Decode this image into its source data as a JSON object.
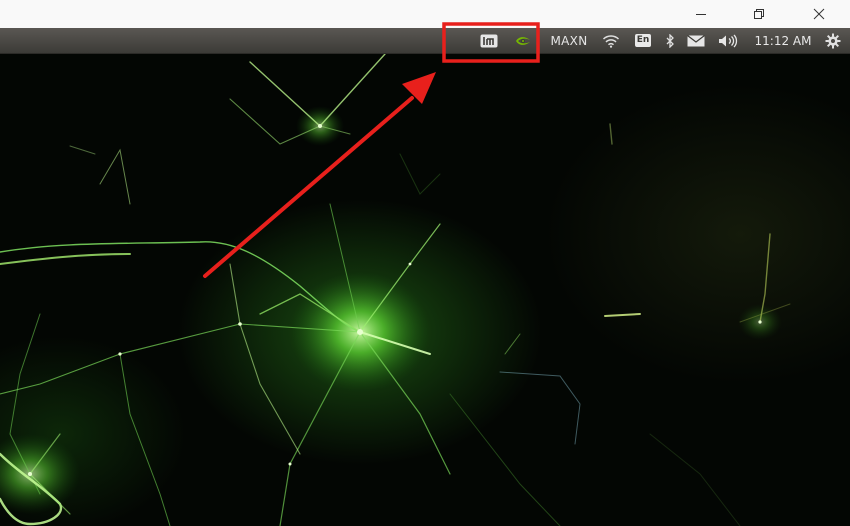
{
  "window_controls": {
    "minimize_icon": "minimize-icon",
    "maximize_icon": "restore-icon",
    "close_icon": "close-icon"
  },
  "panel": {
    "tray": {
      "system_monitor_icon": "jtop-icon",
      "nvidia_icon": "nvidia-icon",
      "power_mode": "MAXN",
      "wifi_icon": "wifi-icon",
      "keyboard_layout": "En",
      "bluetooth_icon": "bluetooth-icon",
      "mail_icon": "mail-icon",
      "volume_icon": "volume-icon",
      "clock": "11:12 AM",
      "settings_icon": "gear-icon"
    }
  },
  "annotation": {
    "highlight_color": "#e8201c",
    "arrow_color": "#e8201c"
  },
  "colors": {
    "panel_bg": "#3c3b37",
    "wallpaper_accent": "#5cff3a"
  }
}
